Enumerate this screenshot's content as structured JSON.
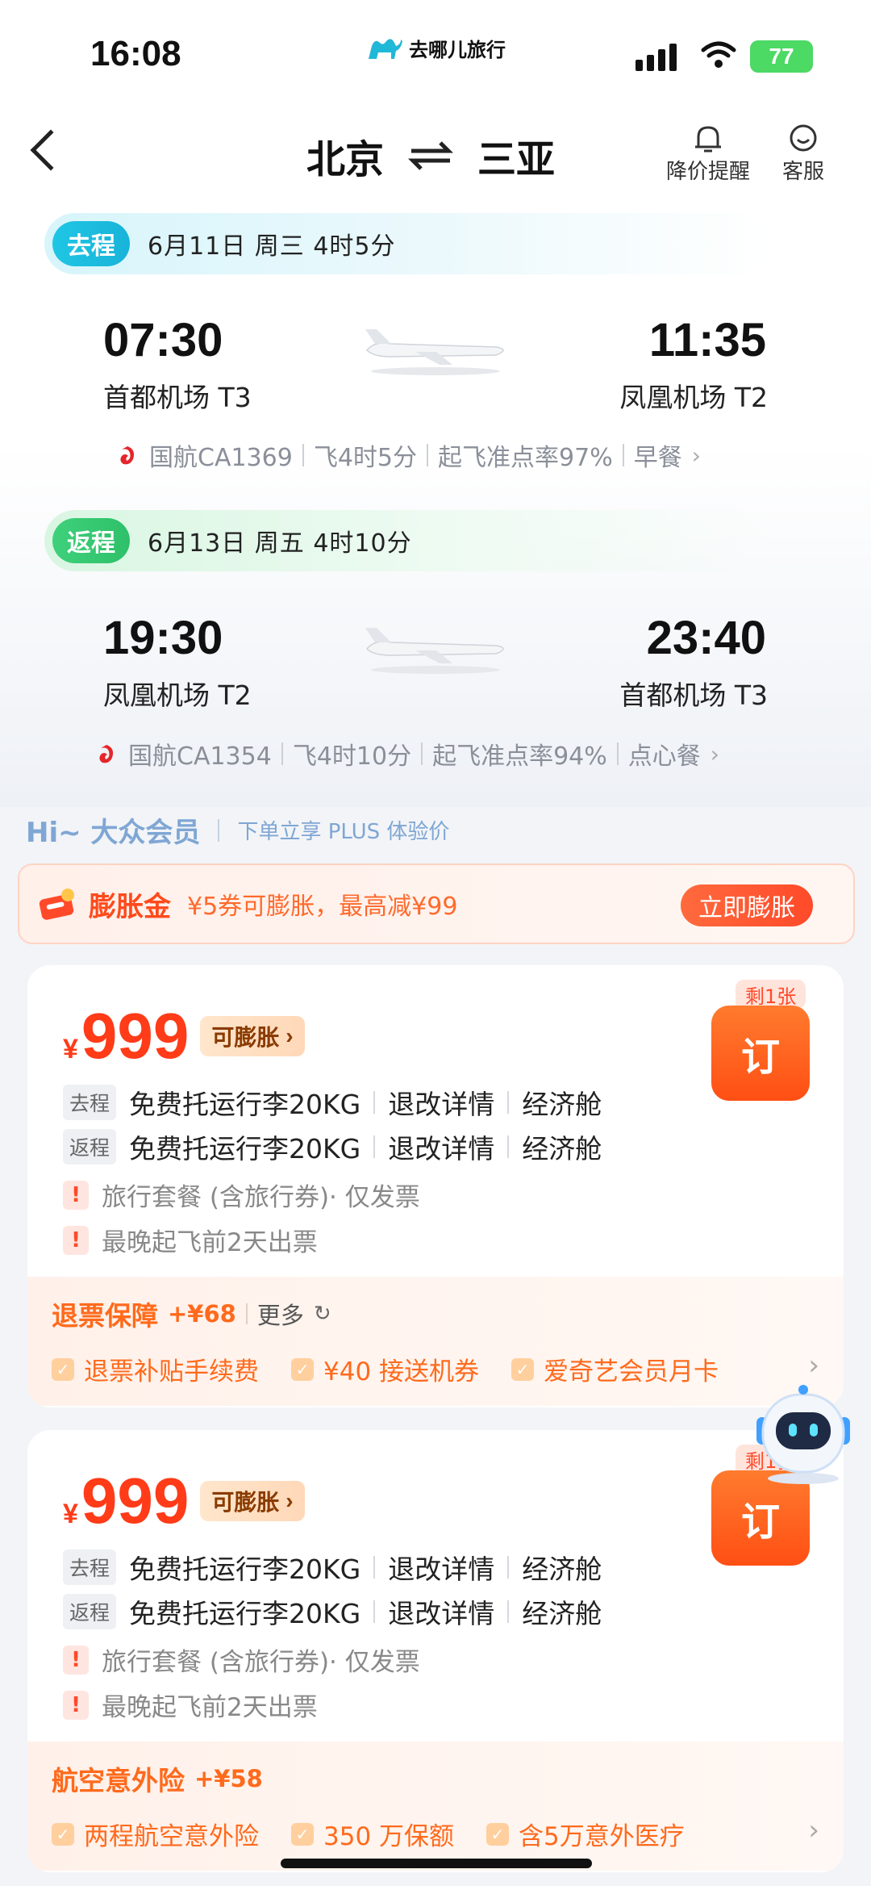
{
  "status": {
    "time": "16:08",
    "battery": "77",
    "app_logo": "去哪儿旅行"
  },
  "header": {
    "from": "北京",
    "to": "三亚",
    "price_alert": "降价提醒",
    "service": "客服"
  },
  "outbound": {
    "tag": "去程",
    "summary": "6月11日 周三  4时5分",
    "dep_time": "07:30",
    "dep_airport": "首都机场 T3",
    "arr_time": "11:35",
    "arr_airport": "凤凰机场 T2",
    "flight": "国航CA1369",
    "duration": "飞4时5分",
    "ontime": "起飞准点率97%",
    "meal": "早餐"
  },
  "return": {
    "tag": "返程",
    "summary": "6月13日 周五  4时10分",
    "dep_time": "19:30",
    "dep_airport": "凤凰机场 T2",
    "arr_time": "23:40",
    "arr_airport": "首都机场 T3",
    "flight": "国航CA1354",
    "duration": "飞4时10分",
    "ontime": "起飞准点率94%",
    "meal": "点心餐"
  },
  "member": {
    "greeting": "Hi~ 大众会员",
    "tip": "下单立享 PLUS 体验价"
  },
  "banner": {
    "title": "膨胀金",
    "desc": "¥5券可膨胀，最高减¥99",
    "button": "立即膨胀"
  },
  "offers": [
    {
      "currency": "¥",
      "price": "999",
      "inflate": "可膨胀",
      "remain": "剩1张",
      "book": "订",
      "rows": [
        {
          "tag": "去程",
          "baggage": "免费托运行李20KG",
          "rules": "退改详情",
          "cabin": "经济舱"
        },
        {
          "tag": "返程",
          "baggage": "免费托运行李20KG",
          "rules": "退改详情",
          "cabin": "经济舱"
        }
      ],
      "notes": [
        "旅行套餐 (含旅行券)· 仅发票",
        "最晚起飞前2天出票"
      ],
      "insurance": {
        "title": "退票保障",
        "price": "+¥68",
        "more": "更多",
        "items": [
          "退票补贴手续费",
          "¥40 接送机券",
          "爱奇艺会员月卡"
        ]
      }
    },
    {
      "currency": "¥",
      "price": "999",
      "inflate": "可膨胀",
      "remain": "剩1张",
      "book": "订",
      "rows": [
        {
          "tag": "去程",
          "baggage": "免费托运行李20KG",
          "rules": "退改详情",
          "cabin": "经济舱"
        },
        {
          "tag": "返程",
          "baggage": "免费托运行李20KG",
          "rules": "退改详情",
          "cabin": "经济舱"
        }
      ],
      "notes": [
        "旅行套餐 (含旅行券)· 仅发票",
        "最晚起飞前2天出票"
      ],
      "insurance": {
        "title": "航空意外险",
        "price": "+¥58",
        "more": "",
        "items": [
          "两程航空意外险",
          "350 万保额",
          "含5万意外医疗"
        ]
      }
    }
  ],
  "colors": {
    "accent": "#ff4a1c",
    "go_tag": "#19b3d9",
    "return_tag": "#2fc06a"
  }
}
